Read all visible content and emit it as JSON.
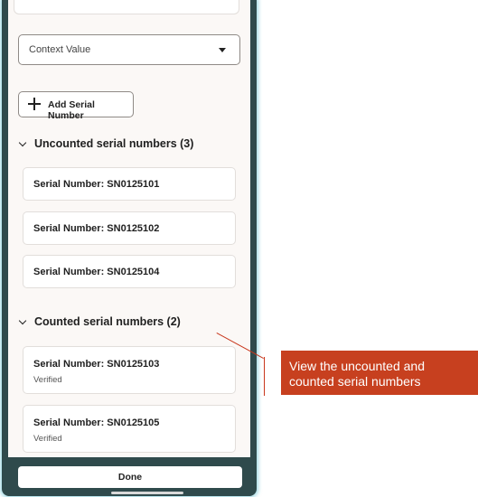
{
  "context_select": {
    "value": "Context Value"
  },
  "add_button": {
    "label": "Add Serial Number"
  },
  "sections": {
    "uncounted": {
      "title": "Uncounted serial numbers (3)",
      "items": [
        {
          "serial": "Serial Number: SN0125101"
        },
        {
          "serial": "Serial Number: SN0125102"
        },
        {
          "serial": "Serial Number: SN0125104"
        }
      ]
    },
    "counted": {
      "title": "Counted serial numbers (2)",
      "items": [
        {
          "serial": "Serial Number: SN0125103",
          "status": "Verified"
        },
        {
          "serial": "Serial Number: SN0125105",
          "status": "Verified"
        }
      ]
    }
  },
  "footer": {
    "done_label": "Done"
  },
  "callout": {
    "text": "View the uncounted and counted serial numbers"
  },
  "colors": {
    "frame": "#2f4a4c",
    "callout": "#c7401f",
    "screen_bg": "#fbf8f6"
  }
}
